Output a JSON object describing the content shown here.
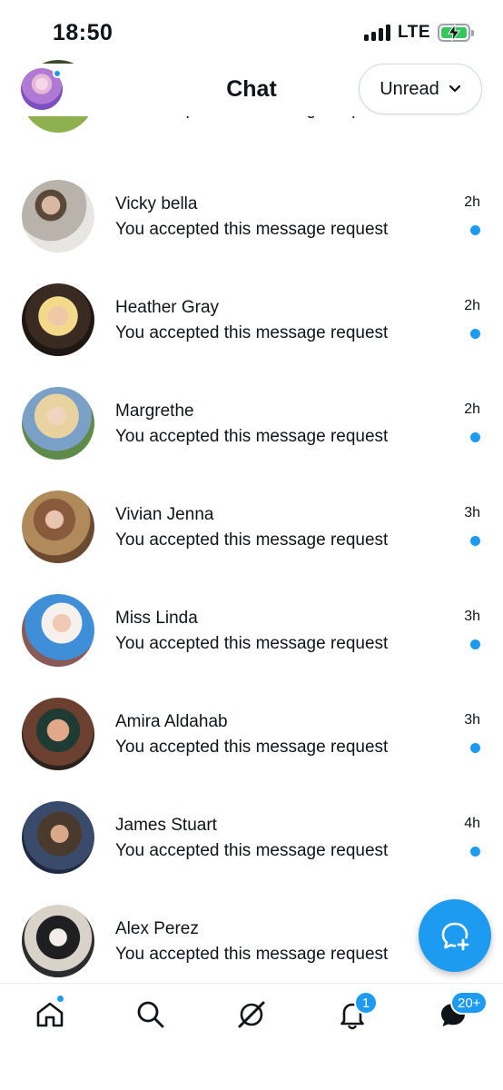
{
  "status_bar": {
    "time": "18:50",
    "network": "LTE"
  },
  "header": {
    "title": "Chat",
    "filter_label": "Unread",
    "avatar_icon": "profile-avatar"
  },
  "conversations": [
    {
      "name": "",
      "message": "You accepted this message request",
      "time": "",
      "unread": true
    },
    {
      "name": "Vicky bella",
      "message": "You accepted this message request",
      "time": "2h",
      "unread": true
    },
    {
      "name": "Heather Gray",
      "message": "You accepted this message request",
      "time": "2h",
      "unread": true
    },
    {
      "name": "Margrethe",
      "message": "You accepted this message request",
      "time": "2h",
      "unread": true
    },
    {
      "name": "Vivian Jenna",
      "message": "You accepted this message request",
      "time": "3h",
      "unread": true
    },
    {
      "name": "Miss Linda",
      "message": "You accepted this message request",
      "time": "3h",
      "unread": true
    },
    {
      "name": "Amira Aldahab",
      "message": "You accepted this message request",
      "time": "3h",
      "unread": true
    },
    {
      "name": "James Stuart",
      "message": "You accepted this message request",
      "time": "4h",
      "unread": true
    },
    {
      "name": "Alex Perez",
      "message": "You accepted this message request",
      "time": "",
      "unread": false
    }
  ],
  "bottom_nav": {
    "items": [
      "home-icon",
      "search-icon",
      "grok-icon",
      "notifications-icon",
      "messages-icon"
    ],
    "notifications_badge": "1",
    "messages_badge": "20+"
  },
  "colors": {
    "accent": "#1d9bf0",
    "text": "#0f1419",
    "battery": "#34c759"
  }
}
